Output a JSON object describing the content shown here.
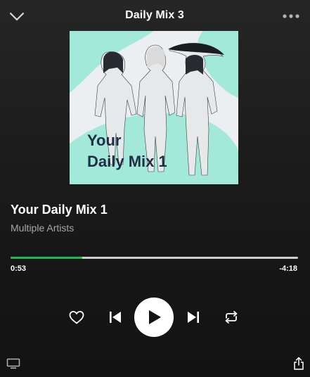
{
  "header": {
    "title": "Daily Mix 3",
    "collapse_icon": "chevron-down-icon",
    "more_icon": "more-horizontal-icon"
  },
  "cover": {
    "line1": "Your",
    "line2": "Daily Mix 1",
    "accent_color": "#9fe8d6",
    "text_color": "#1f2e47"
  },
  "track": {
    "title": "Your Daily Mix 1",
    "artist": "Multiple Artists"
  },
  "playback": {
    "elapsed": "0:53",
    "remaining": "-4:18",
    "progress_fraction": 0.25,
    "progress_color": "#1db954"
  },
  "controls": {
    "like_icon": "heart-icon",
    "previous_icon": "skip-previous-icon",
    "play_icon": "play-icon",
    "next_icon": "skip-next-icon",
    "repeat_icon": "repeat-icon"
  },
  "footer": {
    "devices_icon": "devices-icon",
    "share_icon": "share-icon"
  }
}
